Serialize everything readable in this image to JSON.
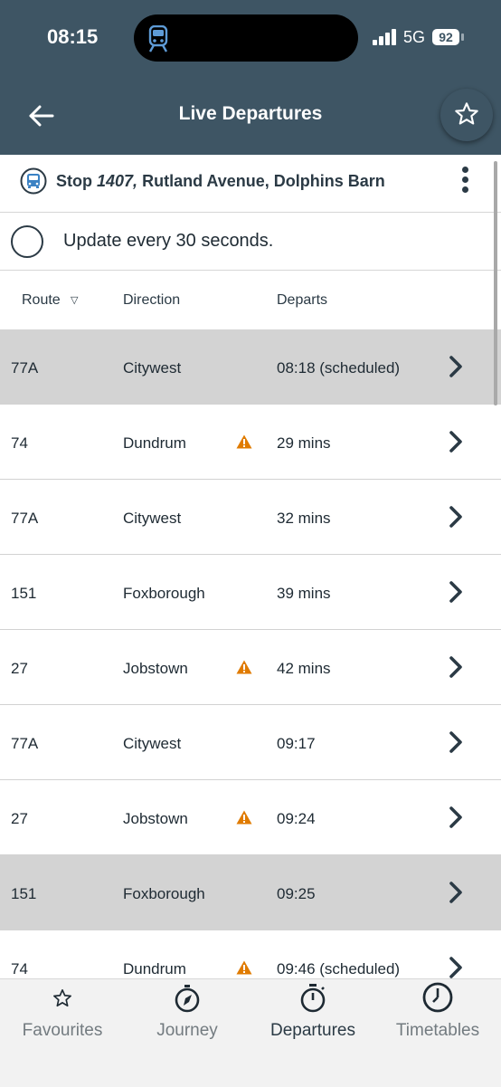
{
  "status_bar": {
    "time": "08:15",
    "network": "5G",
    "battery": "92"
  },
  "header": {
    "title": "Live Departures",
    "back_icon": "arrow-left-icon",
    "favourite_icon": "star-outline-icon"
  },
  "stop": {
    "prefix": "Stop",
    "number": "1407,",
    "name": "Rutland Avenue, Dolphins Barn",
    "icon": "bus-icon"
  },
  "auto_update": {
    "label": "Update every 30 seconds.",
    "checked": false
  },
  "table": {
    "columns": {
      "route": "Route",
      "direction": "Direction",
      "departs": "Departs"
    },
    "rows": [
      {
        "route": "77A",
        "direction": "Citywest",
        "departs": "08:18 (scheduled)",
        "warning": false,
        "highlighted": true
      },
      {
        "route": "74",
        "direction": "Dundrum",
        "departs": "29 mins",
        "warning": true,
        "highlighted": false
      },
      {
        "route": "77A",
        "direction": "Citywest",
        "departs": "32 mins",
        "warning": false,
        "highlighted": false
      },
      {
        "route": "151",
        "direction": "Foxborough",
        "departs": "39 mins",
        "warning": false,
        "highlighted": false
      },
      {
        "route": "27",
        "direction": "Jobstown",
        "departs": "42 mins",
        "warning": true,
        "highlighted": false
      },
      {
        "route": "77A",
        "direction": "Citywest",
        "departs": "09:17",
        "warning": false,
        "highlighted": false
      },
      {
        "route": "27",
        "direction": "Jobstown",
        "departs": "09:24",
        "warning": true,
        "highlighted": false
      },
      {
        "route": "151",
        "direction": "Foxborough",
        "departs": "09:25",
        "warning": false,
        "highlighted": true
      },
      {
        "route": "74",
        "direction": "Dundrum",
        "departs": "09:46 (scheduled)",
        "warning": true,
        "highlighted": false
      }
    ]
  },
  "tabs": [
    {
      "label": "Favourites",
      "icon": "star-icon",
      "active": false
    },
    {
      "label": "Journey",
      "icon": "compass-icon",
      "active": false
    },
    {
      "label": "Departures",
      "icon": "stopwatch-icon",
      "active": true
    },
    {
      "label": "Timetables",
      "icon": "clock-icon",
      "active": false
    }
  ],
  "colors": {
    "header_bg": "#3e5564",
    "warning": "#e07b00",
    "highlight_row": "#d3d3d3"
  }
}
